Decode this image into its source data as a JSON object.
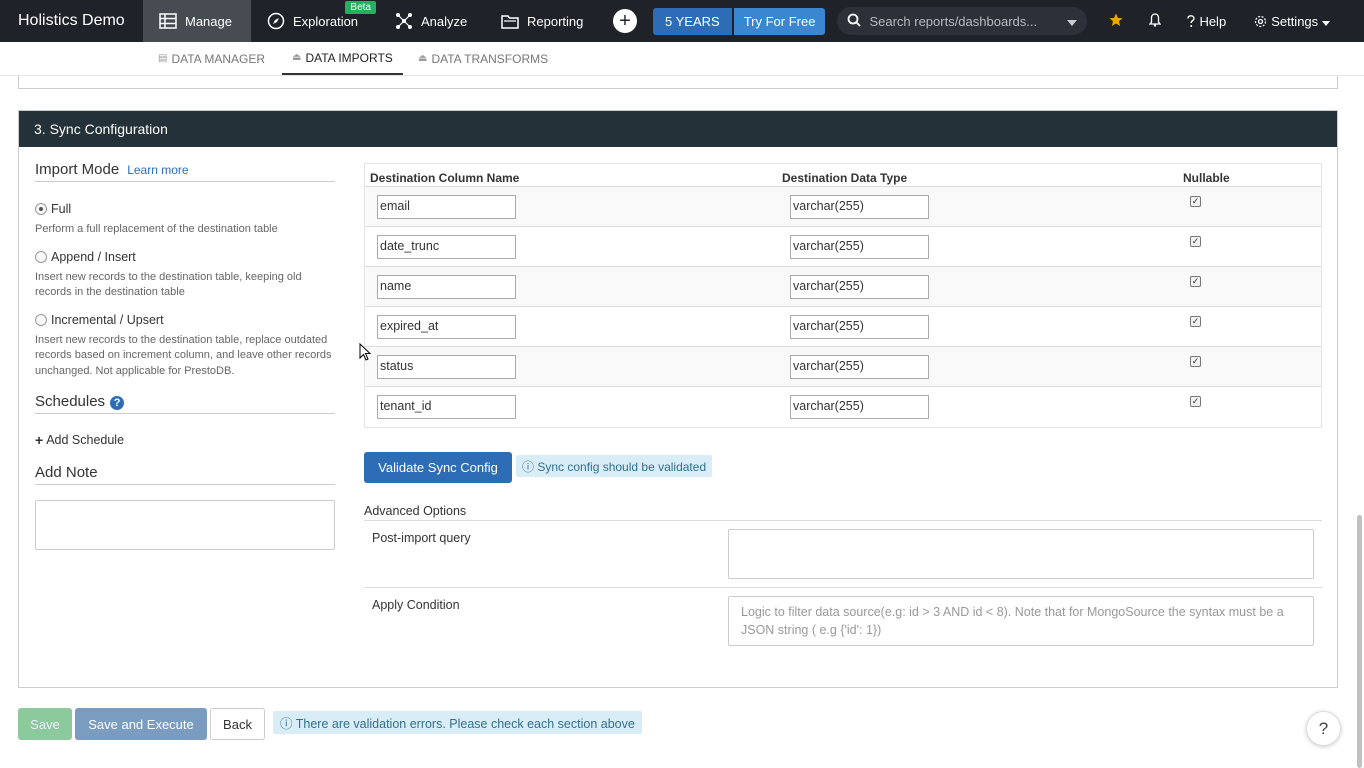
{
  "topnav": {
    "brand": "Holistics Demo",
    "items": [
      {
        "label": "Manage",
        "icon": "manage-icon"
      },
      {
        "label": "Exploration",
        "icon": "compass-icon",
        "badge": "Beta"
      },
      {
        "label": "Analyze",
        "icon": "analyze-icon"
      },
      {
        "label": "Reporting",
        "icon": "folder-icon"
      }
    ],
    "plus_label": "+",
    "years_label": "5 YEARS",
    "try_label": "Try For Free",
    "search_placeholder": "Search reports/dashboards...",
    "help_label": "Help",
    "settings_label": "Settings"
  },
  "subnav": {
    "tabs": [
      {
        "label": "DATA MANAGER"
      },
      {
        "label": "DATA IMPORTS"
      },
      {
        "label": "DATA TRANSFORMS"
      }
    ]
  },
  "section": {
    "title": "3. Sync Configuration",
    "import_mode": {
      "title": "Import Mode",
      "learn_more": "Learn more",
      "options": [
        {
          "label": "Full",
          "desc": "Perform a full replacement of the destination table"
        },
        {
          "label": "Append / Insert",
          "desc": "Insert new records to the destination table, keeping old records in the destination table"
        },
        {
          "label": "Incremental / Upsert",
          "desc": "Insert new records to the destination table, replace outdated records based on increment column, and leave other records unchanged. Not applicable for PrestoDB."
        }
      ]
    },
    "schedules": {
      "title": "Schedules",
      "help": "?",
      "add_label": "Add Schedule"
    },
    "note": {
      "title": "Add Note"
    },
    "table": {
      "headers": [
        "Destination Column Name",
        "Destination Data Type",
        "Nullable"
      ],
      "rows": [
        {
          "name": "email",
          "type": "varchar(255)"
        },
        {
          "name": "date_trunc",
          "type": "varchar(255)"
        },
        {
          "name": "name",
          "type": "varchar(255)"
        },
        {
          "name": "expired_at",
          "type": "varchar(255)"
        },
        {
          "name": "status",
          "type": "varchar(255)"
        },
        {
          "name": "tenant_id",
          "type": "varchar(255)"
        }
      ],
      "check_glyph": "✓"
    },
    "validate_label": "Validate Sync Config",
    "validate_info": "ⓘ Sync config should be validated",
    "advanced": {
      "title": "Advanced Options",
      "post_import_label": "Post-import query",
      "apply_condition_label": "Apply Condition",
      "apply_condition_placeholder": "Logic to filter data source(e.g: id > 3 AND id < 8). Note that for MongoSource the syntax must be a JSON string ( e.g {'id': 1})"
    }
  },
  "footer": {
    "save_label": "Save",
    "save_execute_label": "Save and Execute",
    "back_label": "Back",
    "error_text": "ⓘ There are validation errors. Please check each section above",
    "help_fab": "?"
  }
}
